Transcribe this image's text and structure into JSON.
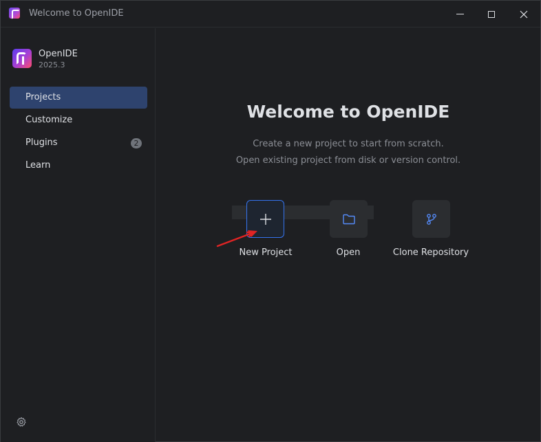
{
  "window": {
    "title": "Welcome to OpenIDE"
  },
  "sidebar": {
    "app_name": "OpenIDE",
    "app_version": "2025.3",
    "items": [
      {
        "label": "Projects",
        "active": true
      },
      {
        "label": "Customize"
      },
      {
        "label": "Plugins",
        "badge": "2"
      },
      {
        "label": "Learn"
      }
    ]
  },
  "main": {
    "title": "Welcome to OpenIDE",
    "subtitle_line1": "Create a new project to start from scratch.",
    "subtitle_line2": "Open existing project from disk or version control.",
    "actions": [
      {
        "label": "New Project",
        "icon": "plus-icon"
      },
      {
        "label": "Open",
        "icon": "folder-icon"
      },
      {
        "label": "Clone Repository",
        "icon": "branch-icon"
      }
    ]
  },
  "colors": {
    "accent": "#3574f0",
    "active_nav": "#2e436e",
    "background": "#1e1f22",
    "annotation_arrow": "#e02424"
  }
}
